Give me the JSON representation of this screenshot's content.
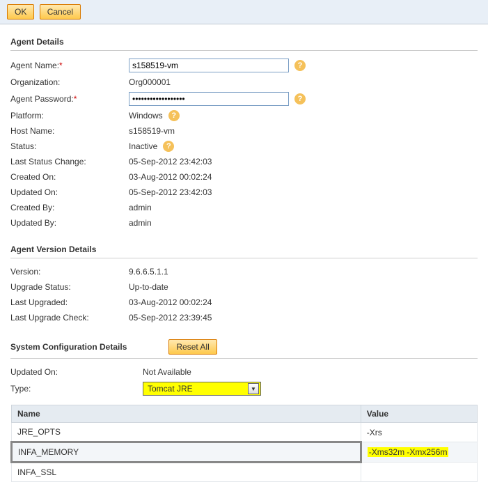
{
  "toolbar": {
    "ok_label": "OK",
    "cancel_label": "Cancel"
  },
  "agent_details": {
    "title": "Agent Details",
    "labels": {
      "agent_name": "Agent Name:",
      "organization": "Organization:",
      "agent_password": "Agent Password:",
      "platform": "Platform:",
      "host_name": "Host Name:",
      "status": "Status:",
      "last_status_change": "Last Status Change:",
      "created_on": "Created On:",
      "updated_on": "Updated On:",
      "created_by": "Created By:",
      "updated_by": "Updated By:"
    },
    "values": {
      "agent_name": "s158519-vm",
      "organization": "Org000001",
      "agent_password": "••••••••••••••••••",
      "platform": "Windows",
      "host_name": "s158519-vm",
      "status": "Inactive",
      "last_status_change": "05-Sep-2012 23:42:03",
      "created_on": "03-Aug-2012 00:02:24",
      "updated_on": "05-Sep-2012 23:42:03",
      "created_by": "admin",
      "updated_by": "admin"
    }
  },
  "version_details": {
    "title": "Agent Version Details",
    "labels": {
      "version": "Version:",
      "upgrade_status": "Upgrade Status:",
      "last_upgraded": "Last Upgraded:",
      "last_upgrade_check": "Last Upgrade Check:"
    },
    "values": {
      "version": "9.6.6.5.1.1",
      "upgrade_status": "Up-to-date",
      "last_upgraded": "03-Aug-2012 00:02:24",
      "last_upgrade_check": "05-Sep-2012 23:39:45"
    }
  },
  "sys_config": {
    "title": "System Configuration Details",
    "reset_label": "Reset All",
    "labels": {
      "updated_on": "Updated On:",
      "type": "Type:"
    },
    "values": {
      "updated_on": "Not Available",
      "type_selected": "Tomcat JRE"
    },
    "table": {
      "col_name": "Name",
      "col_value": "Value",
      "rows": [
        {
          "name": "JRE_OPTS",
          "value": "-Xrs"
        },
        {
          "name": "INFA_MEMORY",
          "value": "-Xms32m -Xmx256m"
        },
        {
          "name": "INFA_SSL",
          "value": ""
        }
      ]
    }
  },
  "help_glyph": "?"
}
